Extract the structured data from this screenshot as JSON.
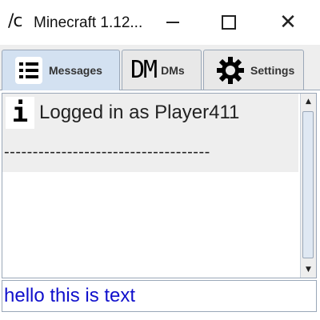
{
  "window": {
    "icon_text": "/c",
    "title": "Minecraft 1.12...",
    "minimize_label": "",
    "maximize_label": "",
    "close_glyph": "✕"
  },
  "tabs": [
    {
      "label": "Messages",
      "icon": "list-icon",
      "active": true
    },
    {
      "label": "DMs",
      "icon": "dm-icon",
      "icon_text": "DM",
      "active": false
    },
    {
      "label": "Settings",
      "icon": "gear-icon",
      "active": false
    }
  ],
  "messages": [
    {
      "icon": "info-icon",
      "icon_text": "i",
      "text": "Logged in as Player411"
    }
  ],
  "divider": "------------------------------------",
  "input": {
    "value": "hello this is text"
  },
  "colors": {
    "active_tab": "#d3e1f1",
    "input_text": "#1010cc",
    "border": "#9aa7b8"
  }
}
